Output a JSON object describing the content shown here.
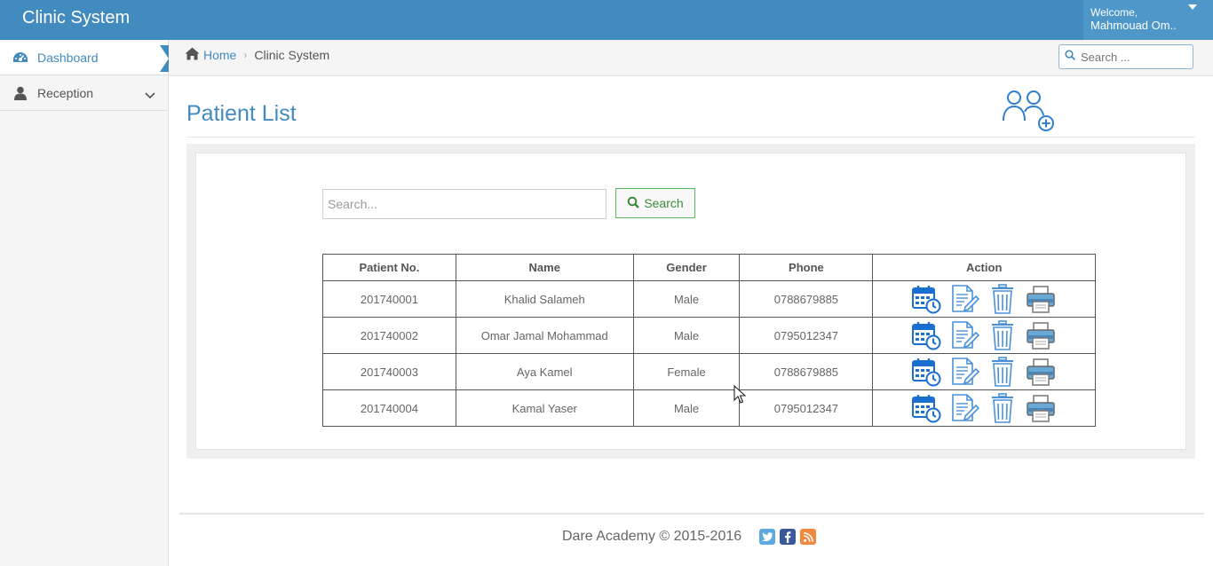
{
  "app": {
    "title": "Clinic System"
  },
  "user": {
    "welcome": "Welcome,",
    "name": "Mahmouad Om.."
  },
  "sidebar": {
    "items": [
      {
        "label": "Dashboard",
        "icon": "dashboard-icon",
        "active": true
      },
      {
        "label": "Reception",
        "icon": "user-icon",
        "active": false
      }
    ]
  },
  "breadcrumb": {
    "home": "Home",
    "current": "Clinic System"
  },
  "top_search": {
    "placeholder": "Search ..."
  },
  "page": {
    "title": "Patient List"
  },
  "search": {
    "placeholder": "Search...",
    "button_label": "Search"
  },
  "table": {
    "headers": [
      "Patient No.",
      "Name",
      "Gender",
      "Phone",
      "Action"
    ],
    "rows": [
      {
        "no": "201740001",
        "name": "Khalid Salameh",
        "gender": "Male",
        "phone": "0788679885"
      },
      {
        "no": "201740002",
        "name": "Omar Jamal Mohammad",
        "gender": "Male",
        "phone": "0795012347"
      },
      {
        "no": "201740003",
        "name": "Aya Kamel",
        "gender": "Female",
        "phone": "0788679885"
      },
      {
        "no": "201740004",
        "name": "Kamal Yaser",
        "gender": "Male",
        "phone": "0795012347"
      }
    ],
    "actions": [
      "calendar-clock-icon",
      "edit-document-icon",
      "trash-icon",
      "printer-icon"
    ]
  },
  "footer": {
    "text": "Dare Academy © 2015-2016",
    "social": [
      "twitter-icon",
      "facebook-icon",
      "rss-icon"
    ]
  },
  "colors": {
    "brand": "#428bbf",
    "search_button_border": "#5cb85c"
  }
}
